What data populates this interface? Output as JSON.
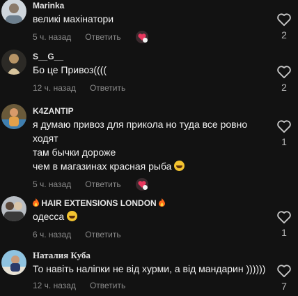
{
  "comments": [
    {
      "author": "Marinka",
      "lines": [
        "великі махінатори"
      ],
      "time": "5 ч. назад",
      "reply": "Ответить",
      "likes": "2",
      "creator_liked": true
    },
    {
      "author": "S__G__",
      "lines": [
        "Бо це Привоз(((("
      ],
      "time": "12 ч. назад",
      "reply": "Ответить",
      "likes": "2",
      "creator_liked": false
    },
    {
      "author": "K4ZANTIP",
      "lines": [
        "я думаю привоз для прикола но туда все ровно",
        "ходят",
        "там бычки дороже",
        "чем в магазинах красная рыба"
      ],
      "time": "5 ч. назад",
      "reply": "Ответить",
      "likes": "1",
      "creator_liked": true
    },
    {
      "author": "HAIR EXTENSIONS LONDON",
      "lines": [
        "одесса"
      ],
      "time": "6 ч. назад",
      "reply": "Ответить",
      "likes": "1",
      "creator_liked": false
    },
    {
      "author": "Наталия Куба",
      "lines": [
        "То навіть наліпки не від хурми, а від мандарин ))))))"
      ],
      "time": "12 ч. назад",
      "reply": "Ответить",
      "likes": "7",
      "creator_liked": false
    }
  ],
  "icons": {
    "like": "heart-outline-icon",
    "creator_like": "creator-liked-badge-icon",
    "emoji": "laughing-emoji-icon",
    "fire": "fire-emoji-icon"
  },
  "colors": {
    "background": "#121212",
    "muted_text": "#8a8a8a",
    "creator_badge": "#e8365d"
  }
}
